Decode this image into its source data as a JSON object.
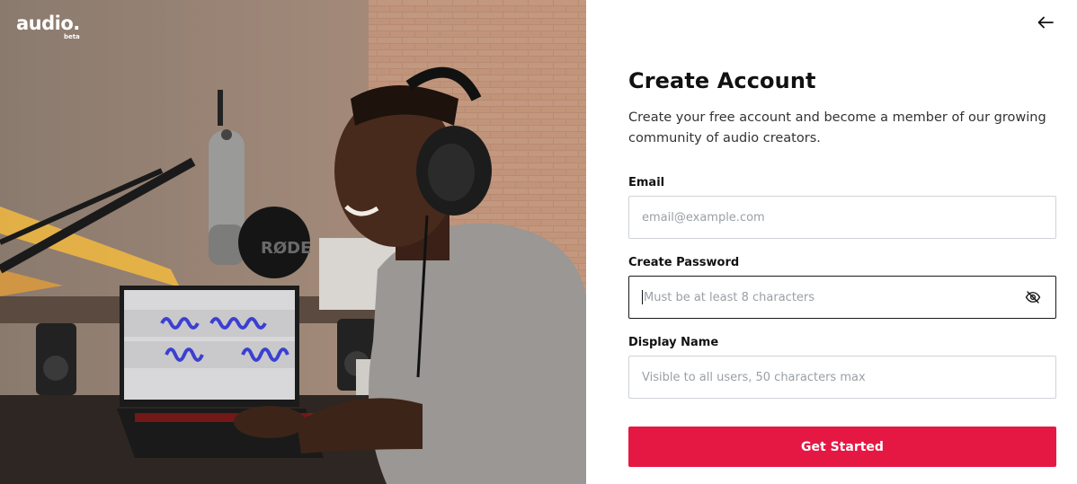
{
  "brand": {
    "name": "audio.",
    "tag": "beta"
  },
  "signup": {
    "title": "Create Account",
    "subtitle": "Create your free account and become a member of our growing community of audio creators.",
    "email": {
      "label": "Email",
      "placeholder": "email@example.com",
      "value": ""
    },
    "password": {
      "label": "Create Password",
      "placeholder": "Must be at least 8 characters",
      "value": ""
    },
    "display_name": {
      "label": "Display Name",
      "placeholder": "Visible to all users, 50 characters max",
      "value": ""
    },
    "submit_label": "Get Started"
  },
  "hero": {
    "mic_brand": "RØDE"
  },
  "icons": {
    "back": "arrow-left-icon",
    "toggle_password": "eye-off-icon"
  },
  "colors": {
    "accent": "#e51844",
    "input_border": "#cfd3d8",
    "focused_border": "#1a1a1a",
    "placeholder": "#9aa0a6"
  }
}
